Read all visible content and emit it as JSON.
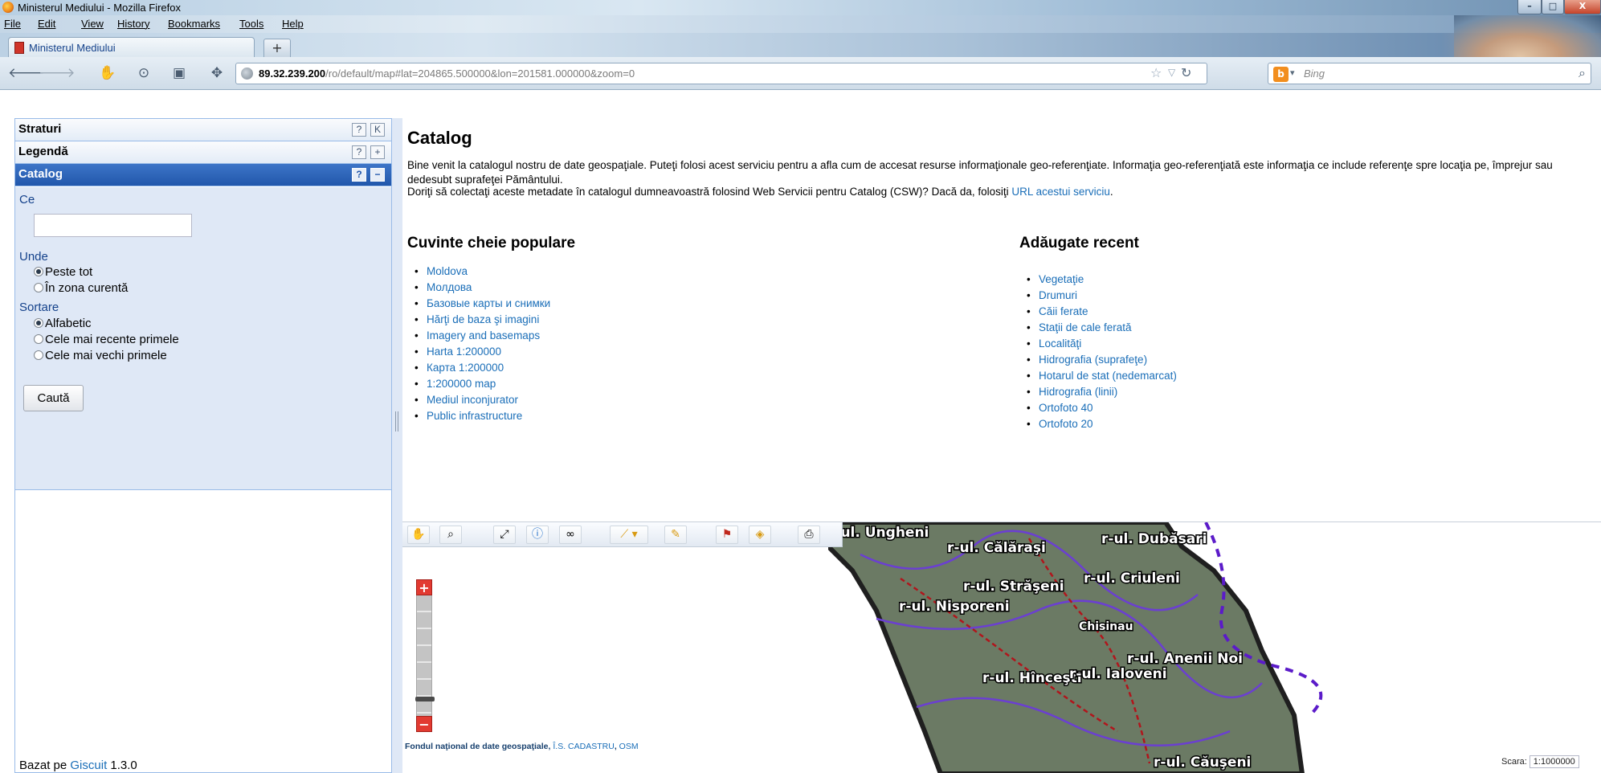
{
  "window": {
    "title": "Ministerul Mediului - Mozilla Firefox",
    "min_glyph": "–",
    "max_glyph": "□",
    "close_glyph": "X"
  },
  "menu": {
    "items": [
      "File",
      "Edit",
      "View",
      "History",
      "Bookmarks",
      "Tools",
      "Help"
    ]
  },
  "tabs": {
    "active_label": "Ministerul Mediului",
    "new_tab_label": "+"
  },
  "nav": {
    "url_host": "89.32.239.200",
    "url_path": "/ro/default/map#lat=204865.500000&lon=201581.000000&zoom=0",
    "search_placeholder": "Bing",
    "search_engine_glyph": "b",
    "icons": [
      "back-arrow-icon",
      "forward-arrow-icon",
      "ninja-icon",
      "history-clock-icon",
      "bookmark-icon",
      "addon-gear-icon"
    ]
  },
  "sidebar": {
    "panels": [
      {
        "label": "Straturi",
        "help": "?",
        "toggle": "K"
      },
      {
        "label": "Legendă",
        "help": "?",
        "toggle": "+"
      },
      {
        "label": "Catalog",
        "help": "?",
        "toggle": "−"
      }
    ],
    "catalog": {
      "ce_label": "Ce",
      "ce_value": "",
      "unde_label": "Unde",
      "unde_options": [
        {
          "label": "Peste tot",
          "selected": true
        },
        {
          "label": "În zona curentă",
          "selected": false
        }
      ],
      "sort_label": "Sortare",
      "sort_options": [
        {
          "label": "Alfabetic",
          "selected": true
        },
        {
          "label": "Cele mai recente primele",
          "selected": false
        },
        {
          "label": "Cele mai vechi primele",
          "selected": false
        }
      ],
      "search_button": "Caută"
    },
    "footer_prefix": "Bazat pe ",
    "footer_link": "Giscuit",
    "footer_version": " 1.3.0"
  },
  "main": {
    "title": "Catalog",
    "intro_text": "Bine venit la catalogul nostru de date geospaţiale. Puteţi folosi acest serviciu pentru a afla cum de accesat resurse informaţionale geo-referenţiate. Informaţia geo-referenţiată este informaţia ce include referenţe spre locaţia pe, împrejur sau dedesubt suprafeţei Pământului.",
    "csw_text": "Doriţi să colectaţi aceste metadate în catalogul dumneavoastră folosind Web Servicii pentru Catalog (CSW)? Dacă da, folosiţi ",
    "csw_link": "URL acestui serviciu",
    "csw_end": ".",
    "popular_heading": "Cuvinte cheie populare",
    "popular_keywords": [
      "Moldova",
      "Молдова",
      "Базовые карты и снимки",
      "Hărţi de baza şi imagini",
      "Imagery and basemaps",
      "Harta 1:200000",
      "Карта 1:200000",
      "1:200000 map",
      "Mediul inconjurator",
      "Public infrastructure"
    ],
    "recent_heading": "Adăugate recent",
    "recent_items": [
      "Vegetaţie",
      "Drumuri",
      "Căii ferate",
      "Staţii de cale ferată",
      "Localităţi",
      "Hidrografia (suprafeţe)",
      "Hotarul de stat (nedemarcat)",
      "Hidrografia (linii)",
      "Ortofoto 40",
      "Ortofoto 20"
    ]
  },
  "map": {
    "toolbar": [
      "pan-hand-icon",
      "zoom-box-icon",
      "zoom-extent-icon",
      "info-icon",
      "binoculars-icon",
      "measure-icon",
      "draw-icon",
      "flag-icon",
      "navigate-icon",
      "print-icon"
    ],
    "zoom_in": "+",
    "zoom_out": "−",
    "labels": [
      "r-ul. Ungheni",
      "r-ul. Dubăsari",
      "r-ul. Călăraşi",
      "r-ul. Criuleni",
      "r-ul. Străşeni",
      "r-ul. Nisporeni",
      "Chisinau",
      "r-ul. Anenii Noi",
      "r-ul. Hînceşti",
      "r-ul. Ialoveni",
      "r-ul. Căuşeni"
    ],
    "attribution_prefix": "Fondul naţional de date geospaţiale",
    "attribution_sep1": ", ",
    "attribution_link1": "Î.S. CADASTRU",
    "attribution_sep2": ", ",
    "attribution_link2": "OSM",
    "scale_label": "Scara:",
    "scale_value": "1:1000000"
  }
}
